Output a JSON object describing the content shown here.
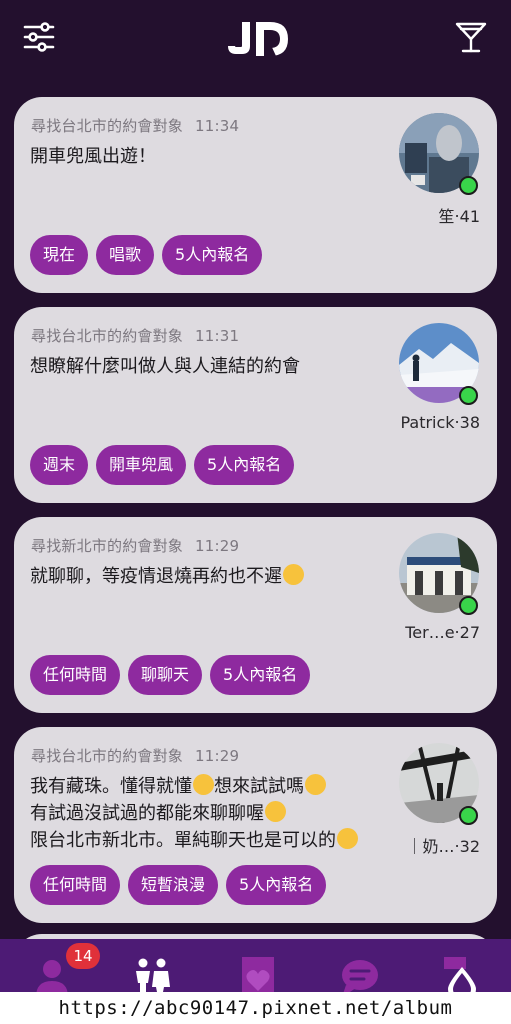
{
  "app": {
    "logo_text": "JD",
    "menu_icon": "sliders-icon",
    "drink_icon": "cocktail-glass-icon"
  },
  "colors": {
    "background": "#23102e",
    "card": "#dedbe0",
    "tag": "#8e2a9f",
    "online": "#39d54a",
    "nav": "#4d1b75",
    "badge": "#e0313a"
  },
  "posts": [
    {
      "search": "尋找台北市的約會對象",
      "time": "11:34",
      "lines": [
        "開車兜風出遊！"
      ],
      "name_age": "笙‧41",
      "tags": [
        "現在",
        "唱歌",
        "5人內報名"
      ],
      "online": true
    },
    {
      "search": "尋找台北市的約會對象",
      "time": "11:31",
      "lines": [
        "想瞭解什麼叫做人與人連結的約會"
      ],
      "name_age": "Patrick‧38",
      "tags": [
        "週末",
        "開車兜風",
        "5人內報名"
      ],
      "online": true
    },
    {
      "search": "尋找新北市的約會對象",
      "time": "11:29",
      "lines": [
        "就聊聊，等疫情退燒再約也不遲"
      ],
      "name_age": "Ter…e‧27",
      "tags": [
        "任何時間",
        "聊聊天",
        "5人內報名"
      ],
      "online": true
    },
    {
      "search": "尋找台北市的約會對象",
      "time": "11:29",
      "lines": [
        "我有藏珠。懂得就懂",
        "想來試試嗎",
        "有試過沒試過的都能來聊聊喔",
        "限台北市新北市。單純聊天也是可以的"
      ],
      "name_age": "｜奶…‧32",
      "tags": [
        "任何時間",
        "短暫浪漫",
        "5人內報名"
      ],
      "online": true
    }
  ],
  "nav": {
    "badge_count": "14",
    "items": [
      "profile-icon",
      "couple-icon",
      "heart-card-icon",
      "chat-icon",
      "drop-icon"
    ]
  },
  "watermark": "https://abc90147.pixnet.net/album"
}
